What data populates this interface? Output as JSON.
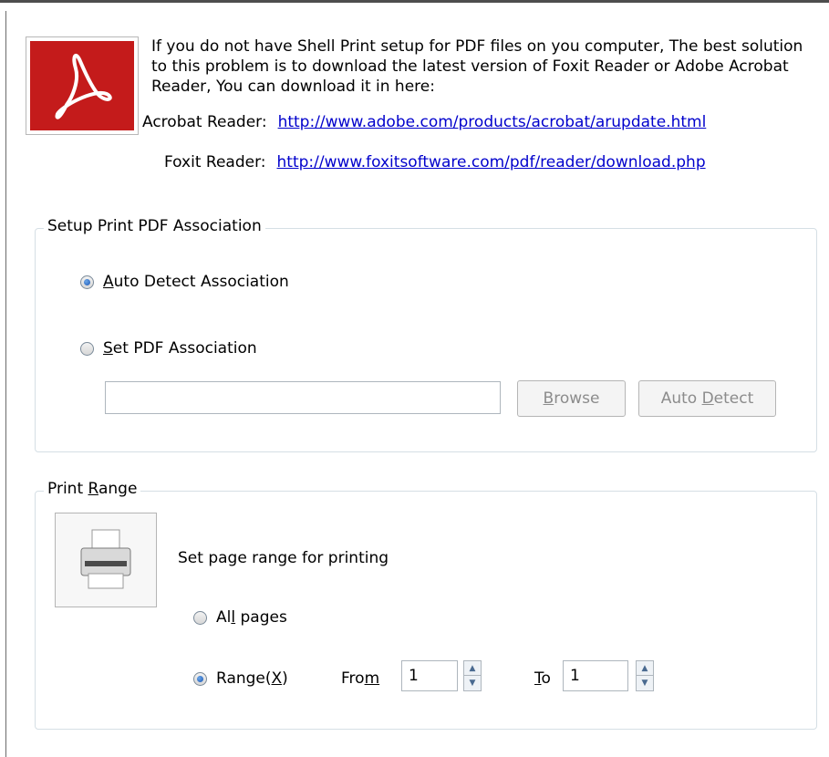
{
  "intro": {
    "text": "If you do not have Shell Print setup for PDF files on you computer, The best solution to this problem is to download the latest version of Foxit Reader or Adobe Acrobat Reader, You can download it in here:",
    "acrobat_label": "Acrobat Reader:",
    "acrobat_url": "http://www.adobe.com/products/acrobat/arupdate.html",
    "foxit_label": "Foxit Reader:",
    "foxit_url": "http://www.foxitsoftware.com/pdf/reader/download.php"
  },
  "association": {
    "title": "Setup Print PDF Association",
    "auto_detect_label_mnemonic": "A",
    "auto_detect_label_rest": "uto Detect Association",
    "set_pdf_label_mnemonic": "S",
    "set_pdf_label_rest": "et PDF Association",
    "path_value": "",
    "browse_mnemonic": "B",
    "browse_rest": "rowse",
    "autodetect_btn_pre": "Auto ",
    "autodetect_btn_mnemonic": "D",
    "autodetect_btn_rest": "etect",
    "selected": "auto"
  },
  "print_range": {
    "title_pre": "Print ",
    "title_mnemonic": "R",
    "title_rest": "ange",
    "description": "Set page range for printing",
    "all_pages_pre": "Al",
    "all_pages_mnemonic": "l",
    "all_pages_rest": " pages",
    "range_pre": "Range(",
    "range_mnemonic": "X",
    "range_rest": ")",
    "from_pre": "Fro",
    "from_mnemonic": "m",
    "to_mnemonic": "T",
    "to_rest": "o",
    "from_value": "1",
    "to_value": "1",
    "selected": "range"
  },
  "colors": {
    "link": "#0000cc",
    "pdf_red": "#c41b1b",
    "group_border": "#d5dfe5"
  }
}
